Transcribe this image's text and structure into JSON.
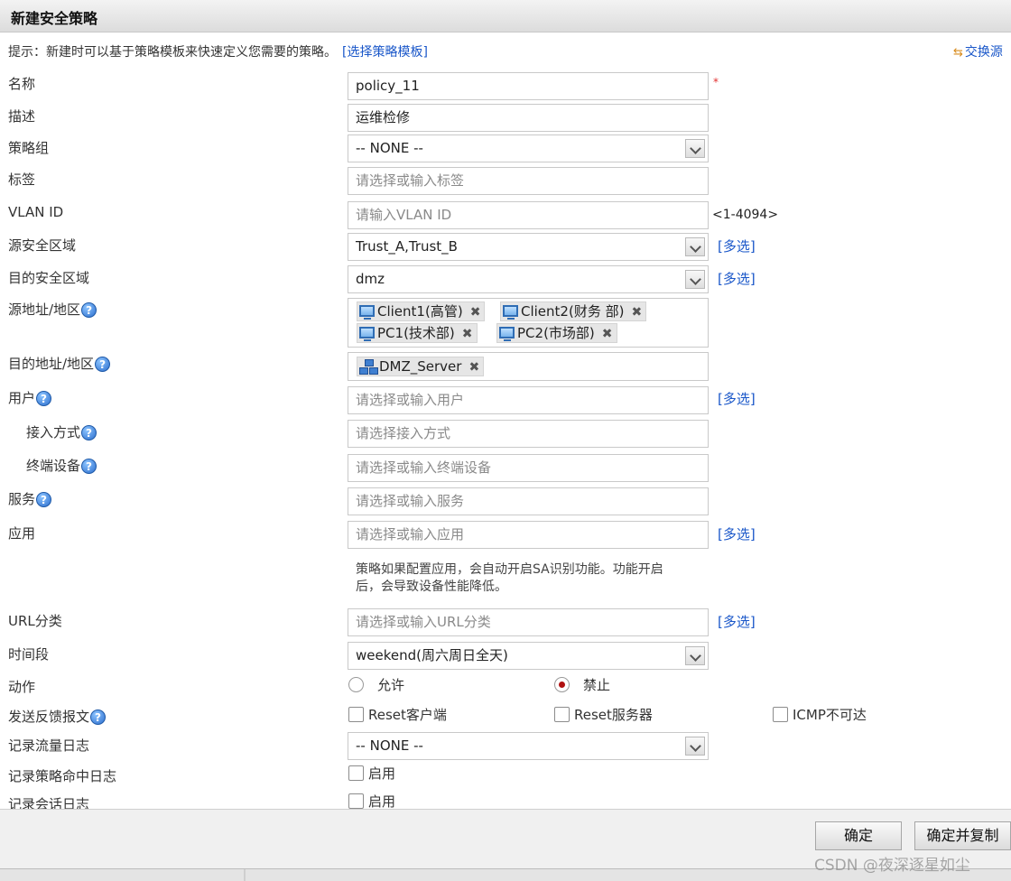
{
  "window": {
    "title": "新建安全策略"
  },
  "hint": {
    "text": "提示：新建时可以基于策略模板来快速定义您需要的策略。",
    "link": "[选择策略模板]"
  },
  "exchange": {
    "label": "交换源"
  },
  "form": {
    "name": {
      "label": "名称",
      "value": "policy_11",
      "required_mark": "*"
    },
    "description": {
      "label": "描述",
      "value": "运维检修"
    },
    "policy_group": {
      "label": "策略组",
      "value": "-- NONE --"
    },
    "tags": {
      "label": "标签",
      "placeholder": "请选择或输入标签"
    },
    "vlan": {
      "label": "VLAN ID",
      "placeholder": "请输入VLAN ID",
      "range": "<1-4094>"
    },
    "src_zone": {
      "label": "源安全区域",
      "value": "Trust_A,Trust_B",
      "multi": "[多选]"
    },
    "dst_zone": {
      "label": "目的安全区域",
      "value": "dmz",
      "multi": "[多选]"
    },
    "src_addr": {
      "label": "源地址/地区",
      "tags": [
        "Client1(高管)",
        "Client2(财务 部)",
        "PC1(技术部)",
        "PC2(市场部)"
      ]
    },
    "dst_addr": {
      "label": "目的地址/地区",
      "tags": [
        "DMZ_Server"
      ]
    },
    "user": {
      "label": "用户",
      "placeholder": "请选择或输入用户",
      "multi": "[多选]"
    },
    "access": {
      "label": "接入方式",
      "placeholder": "请选择接入方式"
    },
    "terminal": {
      "label": "终端设备",
      "placeholder": "请选择或输入终端设备"
    },
    "service": {
      "label": "服务",
      "placeholder": "请选择或输入服务"
    },
    "application": {
      "label": "应用",
      "placeholder": "请选择或输入应用",
      "multi": "[多选]",
      "note_line1": "策略如果配置应用，会自动开启SA识别功能。功能开启",
      "note_line2": "后，会导致设备性能降低。"
    },
    "url": {
      "label": "URL分类",
      "placeholder": "请选择或输入URL分类",
      "multi": "[多选]"
    },
    "time": {
      "label": "时间段",
      "value": "weekend(周六周日全天)"
    },
    "action": {
      "label": "动作",
      "allow": "允许",
      "deny": "禁止",
      "selected": "deny"
    },
    "feedback": {
      "label": "发送反馈报文",
      "reset_client": "Reset客户端",
      "reset_server": "Reset服务器",
      "icmp": "ICMP不可达"
    },
    "traffic_log": {
      "label": "记录流量日志",
      "value": "-- NONE --"
    },
    "hit_log": {
      "label": "记录策略命中日志",
      "enable": "启用"
    },
    "session_log": {
      "label": "记录会话日志",
      "enable": "启用"
    }
  },
  "buttons": {
    "ok": "确定",
    "ok_copy": "确定并复制"
  },
  "watermark": "CSDN @夜深逐星如尘",
  "icons": {
    "help": "help-icon",
    "pc": "computer-icon",
    "server": "network-icon",
    "remove": "remove-icon",
    "exchange": "exchange-icon"
  }
}
